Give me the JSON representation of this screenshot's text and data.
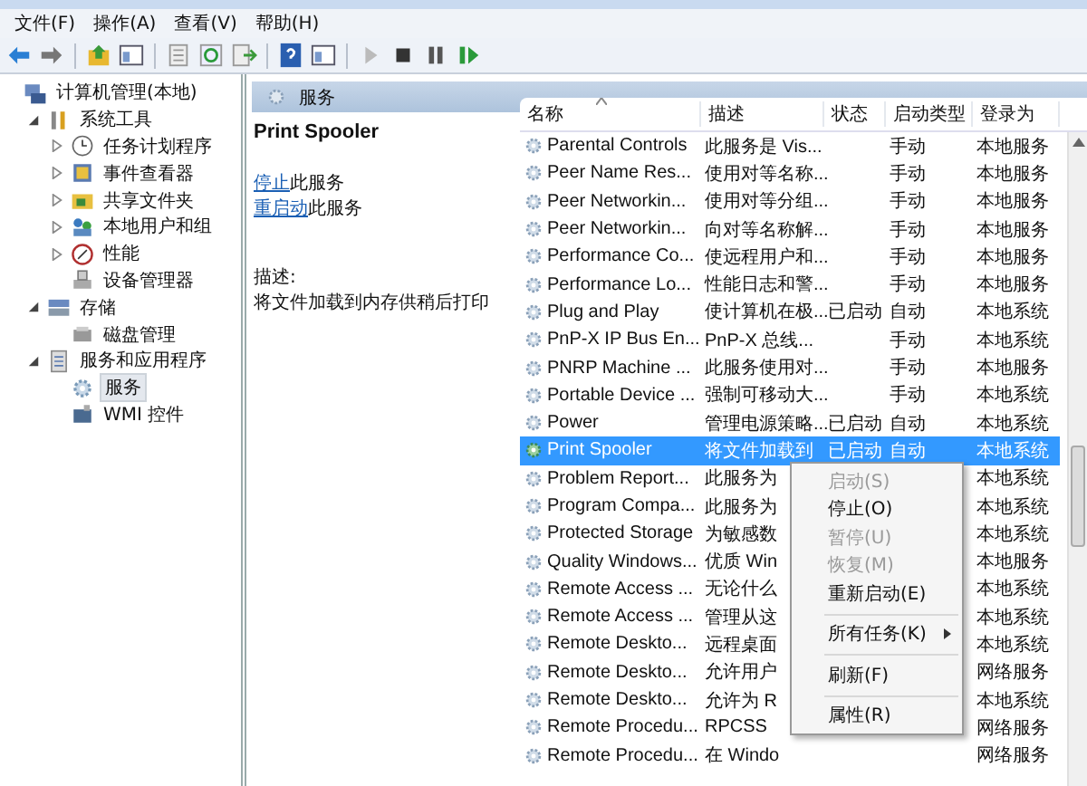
{
  "menu_bar": [
    "文件(F)",
    "操作(A)",
    "查看(V)",
    "帮助(H)"
  ],
  "tree": [
    {
      "label": "计算机管理(本地)",
      "selected": false,
      "children": [
        {
          "label": "系统工具",
          "selected": false,
          "expanded": true,
          "children": [
            {
              "label": "任务计划程序",
              "selected": false,
              "expanded": false
            },
            {
              "label": "事件查看器",
              "selected": false,
              "expanded": false
            },
            {
              "label": "共享文件夹",
              "selected": false,
              "expanded": false
            },
            {
              "label": "本地用户和组",
              "selected": false,
              "expanded": false
            },
            {
              "label": "性能",
              "selected": false,
              "expanded": false
            },
            {
              "label": "设备管理器",
              "selected": false
            }
          ]
        },
        {
          "label": "存储",
          "selected": false,
          "expanded": true,
          "children": [
            {
              "label": "磁盘管理",
              "selected": false
            }
          ]
        },
        {
          "label": "服务和应用程序",
          "selected": false,
          "expanded": true,
          "children": [
            {
              "label": "服务",
              "selected": true
            },
            {
              "label": "WMI 控件",
              "selected": false
            }
          ]
        }
      ]
    }
  ],
  "pane_header": {
    "title": "服务"
  },
  "details": {
    "service_name": "Print Spooler",
    "actions": [
      {
        "link": "停止",
        "text": "此服务"
      },
      {
        "link": "重启动",
        "text": "此服务"
      }
    ],
    "description_label": "描述:",
    "description": "将文件加载到内存供稍后打印"
  },
  "table": {
    "columns": [
      "名称",
      "描述",
      "状态",
      "启动类型",
      "登录为"
    ],
    "rows": [
      {
        "name": "Parental Controls",
        "description": "此服务是 Vis...",
        "startup": "手动",
        "log_on_as": "本地服务",
        "selected": false
      },
      {
        "name": "Peer Name Res...",
        "description": "使用对等名称...",
        "startup": "手动",
        "log_on_as": "本地服务",
        "selected": false
      },
      {
        "name": "Peer Networkin...",
        "description": "使用对等分组...",
        "startup": "手动",
        "log_on_as": "本地服务",
        "selected": false
      },
      {
        "name": "Peer Networkin...",
        "description": "向对等名称解...",
        "startup": "手动",
        "log_on_as": "本地服务",
        "selected": false
      },
      {
        "name": "Performance Co...",
        "description": "使远程用户和...",
        "startup": "手动",
        "log_on_as": "本地服务",
        "selected": false
      },
      {
        "name": "Performance Lo...",
        "description": "性能日志和警...",
        "startup": "手动",
        "log_on_as": "本地服务",
        "selected": false
      },
      {
        "name": "Plug and Play",
        "description": "使计算机在极...",
        "status": "已启动",
        "startup": "自动",
        "log_on_as": "本地系统",
        "selected": false
      },
      {
        "name": "PnP-X IP Bus En...",
        "description": "PnP-X 总线...",
        "startup": "手动",
        "log_on_as": "本地系统",
        "selected": false
      },
      {
        "name": "PNRP Machine ...",
        "description": "此服务使用对...",
        "startup": "手动",
        "log_on_as": "本地服务",
        "selected": false
      },
      {
        "name": "Portable Device ...",
        "description": "强制可移动大...",
        "startup": "手动",
        "log_on_as": "本地系统",
        "selected": false
      },
      {
        "name": "Power",
        "description": "管理电源策略...",
        "status": "已启动",
        "startup": "自动",
        "log_on_as": "本地系统",
        "selected": false
      },
      {
        "name": "Print Spooler",
        "description": "将文件加载到",
        "status": "已启动",
        "startup": "自动",
        "log_on_as": "本地系统",
        "selected": true
      },
      {
        "name": "Problem Report...",
        "description": "此服务为",
        "log_on_as": "本地系统",
        "selected": false
      },
      {
        "name": "Program Compa...",
        "description": "此服务为",
        "log_on_as": "本地系统",
        "selected": false
      },
      {
        "name": "Protected Storage",
        "description": "为敏感数",
        "log_on_as": "本地系统",
        "selected": false
      },
      {
        "name": "Quality Windows...",
        "description": "优质 Win",
        "log_on_as": "本地服务",
        "selected": false
      },
      {
        "name": "Remote Access ...",
        "description": "无论什么",
        "log_on_as": "本地系统",
        "selected": false
      },
      {
        "name": "Remote Access ...",
        "description": "管理从这",
        "log_on_as": "本地系统",
        "selected": false
      },
      {
        "name": "Remote Deskto...",
        "description": "远程桌面",
        "log_on_as": "本地系统",
        "selected": false
      },
      {
        "name": "Remote Deskto...",
        "description": "允许用户",
        "log_on_as": "网络服务",
        "selected": false
      },
      {
        "name": "Remote Deskto...",
        "description": "允许为 R",
        "log_on_as": "本地系统",
        "selected": false
      },
      {
        "name": "Remote Procedu...",
        "description": "RPCSS",
        "log_on_as": "网络服务",
        "selected": false
      },
      {
        "name": "Remote Procedu...",
        "description": "在 Windo",
        "log_on_as": "网络服务",
        "selected": false
      }
    ]
  },
  "context_menu": [
    {
      "kind": "item",
      "label": "启动(S)",
      "disabled": true
    },
    {
      "kind": "item",
      "label": "停止(O)",
      "disabled": false
    },
    {
      "kind": "item",
      "label": "暂停(U)",
      "disabled": true
    },
    {
      "kind": "item",
      "label": "恢复(M)",
      "disabled": true
    },
    {
      "kind": "item",
      "label": "重新启动(E)",
      "disabled": false
    },
    {
      "kind": "separator"
    },
    {
      "kind": "submenu",
      "label": "所有任务(K)",
      "disabled": false
    },
    {
      "kind": "separator"
    },
    {
      "kind": "item",
      "label": "刷新(F)",
      "disabled": false
    },
    {
      "kind": "separator"
    },
    {
      "kind": "item",
      "label": "属性(R)",
      "disabled": false
    }
  ]
}
